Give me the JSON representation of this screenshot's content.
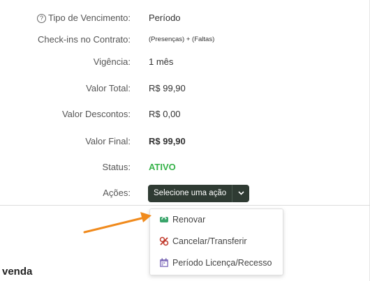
{
  "details": {
    "tipo_vencimento": {
      "label": "Tipo de Vencimento:",
      "value": "Período"
    },
    "checkins": {
      "label": "Check-ins no Contrato:",
      "value": "(Presenças) + (Faltas)"
    },
    "vigencia": {
      "label": "Vigência:",
      "value": "1 mês"
    },
    "valor_total": {
      "label": "Valor Total:",
      "value": "R$ 99,90"
    },
    "valor_descontos": {
      "label": "Valor Descontos:",
      "value": "R$ 0,00"
    },
    "valor_final": {
      "label": "Valor Final:",
      "value": "R$ 99,90"
    },
    "status": {
      "label": "Status:",
      "value": "ATIVO",
      "color": "#37b34a"
    },
    "acoes": {
      "label": "Ações:"
    }
  },
  "action_button": {
    "label": "Selecione uma ação",
    "color": "#2f3b33"
  },
  "dropdown": {
    "items": [
      {
        "label": "Renovar",
        "icon": "renew-icon",
        "icon_color": "#3aa56b"
      },
      {
        "label": "Cancelar/Transferir",
        "icon": "cancel-icon",
        "icon_color": "#c0392b"
      },
      {
        "label": "Período Licença/Recesso",
        "icon": "calendar-icon",
        "icon_color": "#8e7cc3"
      }
    ]
  },
  "annotation_arrow_color": "#f08a1c",
  "section_title": "venda"
}
